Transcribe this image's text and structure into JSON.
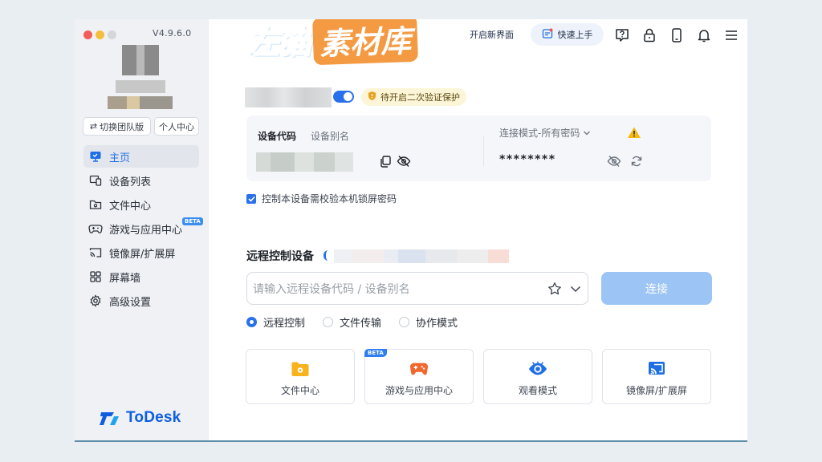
{
  "sidebar": {
    "version": "V4.9.6.0",
    "switch_team": "切换团队版",
    "personal_center": "个人中心",
    "items": [
      {
        "label": "主页",
        "icon": "monitor-icon"
      },
      {
        "label": "设备列表",
        "icon": "devices-icon"
      },
      {
        "label": "文件中心",
        "icon": "folder-icon"
      },
      {
        "label": "游戏与应用中心",
        "icon": "gamepad-icon",
        "badge": "BETA"
      },
      {
        "label": "镜像屏/扩展屏",
        "icon": "cast-icon"
      },
      {
        "label": "屏幕墙",
        "icon": "grid-icon"
      },
      {
        "label": "高级设置",
        "icon": "gear-icon"
      }
    ],
    "logo": "ToDesk"
  },
  "watermark": {
    "left": "左猫",
    "right": "素材库"
  },
  "topbar": {
    "new_ui": "开启新界面",
    "quick_start": "快速上手"
  },
  "device": {
    "verify_badge": "待开启二次验证保护",
    "code_label": "设备代码",
    "alias_label": "设备别名",
    "mode": "连接模式-所有密码",
    "password": "********"
  },
  "checkbox_label": "控制本设备需校验本机锁屏密码",
  "remote": {
    "title": "远程控制设备",
    "placeholder": "请输入远程设备代码 / 设备别名",
    "connect": "连接",
    "modes": [
      "远程控制",
      "文件传输",
      "协作模式"
    ]
  },
  "tiles": [
    {
      "label": "文件中心"
    },
    {
      "label": "游戏与应用中心",
      "badge": "BETA"
    },
    {
      "label": "观看模式"
    },
    {
      "label": "镜像屏/扩展屏"
    }
  ],
  "colors": {
    "accent": "#2871ea",
    "connect_disabled": "#9cc4f4",
    "watermark_blue": "#2a8ef4",
    "watermark_orange": "#f49a43"
  }
}
